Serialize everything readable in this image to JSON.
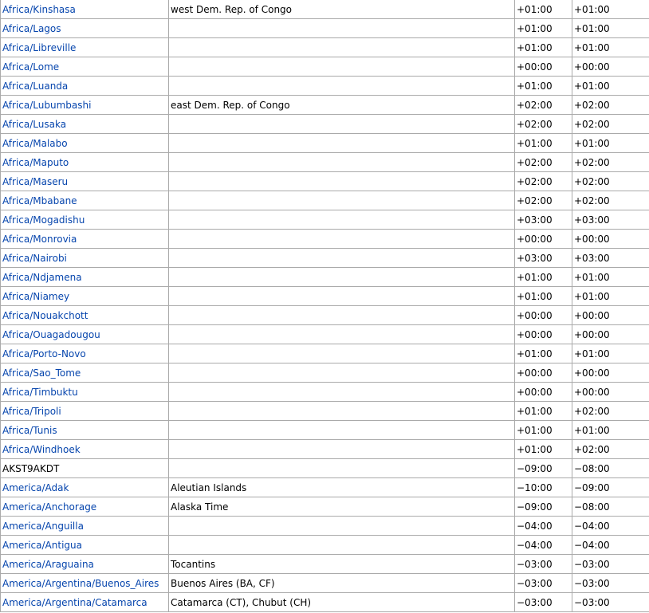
{
  "rows": [
    {
      "name": "Africa/Kinshasa",
      "link": true,
      "comment": "west Dem. Rep. of Congo",
      "std": "+01:00",
      "dst": "+01:00"
    },
    {
      "name": "Africa/Lagos",
      "link": true,
      "comment": "",
      "std": "+01:00",
      "dst": "+01:00"
    },
    {
      "name": "Africa/Libreville",
      "link": true,
      "comment": "",
      "std": "+01:00",
      "dst": "+01:00"
    },
    {
      "name": "Africa/Lome",
      "link": true,
      "comment": "",
      "std": "+00:00",
      "dst": "+00:00"
    },
    {
      "name": "Africa/Luanda",
      "link": true,
      "comment": "",
      "std": "+01:00",
      "dst": "+01:00"
    },
    {
      "name": "Africa/Lubumbashi",
      "link": true,
      "comment": "east Dem. Rep. of Congo",
      "std": "+02:00",
      "dst": "+02:00"
    },
    {
      "name": "Africa/Lusaka",
      "link": true,
      "comment": "",
      "std": "+02:00",
      "dst": "+02:00"
    },
    {
      "name": "Africa/Malabo",
      "link": true,
      "comment": "",
      "std": "+01:00",
      "dst": "+01:00"
    },
    {
      "name": "Africa/Maputo",
      "link": true,
      "comment": "",
      "std": "+02:00",
      "dst": "+02:00"
    },
    {
      "name": "Africa/Maseru",
      "link": true,
      "comment": "",
      "std": "+02:00",
      "dst": "+02:00"
    },
    {
      "name": "Africa/Mbabane",
      "link": true,
      "comment": "",
      "std": "+02:00",
      "dst": "+02:00"
    },
    {
      "name": "Africa/Mogadishu",
      "link": true,
      "comment": "",
      "std": "+03:00",
      "dst": "+03:00"
    },
    {
      "name": "Africa/Monrovia",
      "link": true,
      "comment": "",
      "std": "+00:00",
      "dst": "+00:00"
    },
    {
      "name": "Africa/Nairobi",
      "link": true,
      "comment": "",
      "std": "+03:00",
      "dst": "+03:00"
    },
    {
      "name": "Africa/Ndjamena",
      "link": true,
      "comment": "",
      "std": "+01:00",
      "dst": "+01:00"
    },
    {
      "name": "Africa/Niamey",
      "link": true,
      "comment": "",
      "std": "+01:00",
      "dst": "+01:00"
    },
    {
      "name": "Africa/Nouakchott",
      "link": true,
      "comment": "",
      "std": "+00:00",
      "dst": "+00:00"
    },
    {
      "name": "Africa/Ouagadougou",
      "link": true,
      "comment": "",
      "std": "+00:00",
      "dst": "+00:00"
    },
    {
      "name": "Africa/Porto-Novo",
      "link": true,
      "comment": "",
      "std": "+01:00",
      "dst": "+01:00"
    },
    {
      "name": "Africa/Sao_Tome",
      "link": true,
      "comment": "",
      "std": "+00:00",
      "dst": "+00:00"
    },
    {
      "name": "Africa/Timbuktu",
      "link": true,
      "comment": "",
      "std": "+00:00",
      "dst": "+00:00"
    },
    {
      "name": "Africa/Tripoli",
      "link": true,
      "comment": "",
      "std": "+01:00",
      "dst": "+02:00"
    },
    {
      "name": "Africa/Tunis",
      "link": true,
      "comment": "",
      "std": "+01:00",
      "dst": "+01:00"
    },
    {
      "name": "Africa/Windhoek",
      "link": true,
      "comment": "",
      "std": "+01:00",
      "dst": "+02:00"
    },
    {
      "name": "AKST9AKDT",
      "link": false,
      "comment": "",
      "std": "−09:00",
      "dst": "−08:00"
    },
    {
      "name": "America/Adak",
      "link": true,
      "comment": "Aleutian Islands",
      "std": "−10:00",
      "dst": "−09:00"
    },
    {
      "name": "America/Anchorage",
      "link": true,
      "comment": "Alaska Time",
      "std": "−09:00",
      "dst": "−08:00"
    },
    {
      "name": "America/Anguilla",
      "link": true,
      "comment": "",
      "std": "−04:00",
      "dst": "−04:00"
    },
    {
      "name": "America/Antigua",
      "link": true,
      "comment": "",
      "std": "−04:00",
      "dst": "−04:00"
    },
    {
      "name": "America/Araguaina",
      "link": true,
      "comment": "Tocantins",
      "std": "−03:00",
      "dst": "−03:00"
    },
    {
      "name": "America/Argentina/Buenos_Aires",
      "link": true,
      "comment": "Buenos Aires (BA, CF)",
      "std": "−03:00",
      "dst": "−03:00"
    },
    {
      "name": "America/Argentina/Catamarca",
      "link": true,
      "comment": "Catamarca (CT), Chubut (CH)",
      "std": "−03:00",
      "dst": "−03:00"
    }
  ]
}
